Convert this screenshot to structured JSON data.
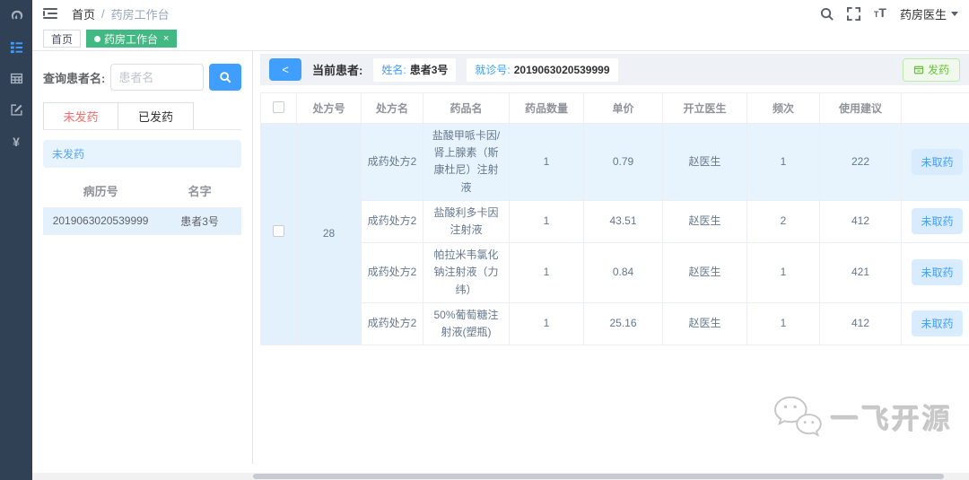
{
  "header": {
    "breadcrumb": {
      "home": "首页",
      "separator": "/",
      "current": "药房工作台"
    },
    "user": "药房医生",
    "icons": {
      "search": "magnifier",
      "fullscreen": "expand-arrows",
      "font_size": "tT",
      "user_caret": "caret-down"
    }
  },
  "sidebar": {
    "items": [
      {
        "icon": "dashboard-icon",
        "active": false
      },
      {
        "icon": "menu-list-icon",
        "active": true
      },
      {
        "icon": "table-grid-icon",
        "active": false
      },
      {
        "icon": "edit-icon",
        "active": false
      },
      {
        "icon": "currency-yen-icon",
        "active": false
      }
    ],
    "yen_glyph": "¥"
  },
  "tags": {
    "home": "首页",
    "active": "药房工作台",
    "close": "×"
  },
  "left_panel": {
    "search_label": "查询患者名:",
    "search_placeholder": "患者名",
    "tab_undispensed": "未发药",
    "tab_dispensed": "已发药",
    "alert": "未发药",
    "patient_table": {
      "headers": {
        "record_no": "病历号",
        "name": "名字"
      },
      "rows": [
        {
          "record_no": "2019063020539999",
          "name": "患者3号"
        }
      ]
    }
  },
  "main": {
    "back_label": "<",
    "current_patient_label": "当前患者:",
    "name_label": "姓名:",
    "name_value": "患者3号",
    "visit_label": "就诊号:",
    "visit_value": "2019063020539999",
    "dispense_button": "发药",
    "table": {
      "headers": [
        "处方号",
        "处方名",
        "药品名",
        "药品数量",
        "单价",
        "开立医生",
        "频次",
        "使用建议"
      ],
      "prescription_no": "28",
      "rows": [
        {
          "rx_name": "成药处方2",
          "drug": "盐酸甲哌卡因/肾上腺素（斯康杜尼）注射液",
          "qty": "1",
          "price": "0.79",
          "doctor": "赵医生",
          "freq": "1",
          "advice": "222",
          "action": "未取药"
        },
        {
          "rx_name": "成药处方2",
          "drug": "盐酸利多卡因注射液",
          "qty": "1",
          "price": "43.51",
          "doctor": "赵医生",
          "freq": "2",
          "advice": "412",
          "action": "未取药"
        },
        {
          "rx_name": "成药处方2",
          "drug": "帕拉米韦氯化钠注射液（力纬）",
          "qty": "1",
          "price": "0.84",
          "doctor": "赵医生",
          "freq": "1",
          "advice": "421",
          "action": "未取药"
        },
        {
          "rx_name": "成药处方2",
          "drug": "50%葡萄糖注射液(塑瓶)",
          "qty": "1",
          "price": "25.16",
          "doctor": "赵医生",
          "freq": "1",
          "advice": "412",
          "action": "未取药"
        }
      ]
    }
  },
  "watermark": {
    "text": "一飞开源"
  },
  "colors": {
    "accent_blue": "#409eff",
    "tag_green": "#42b983",
    "sidebar_bg": "#304156",
    "success_text": "#67c23a",
    "row_highlight": "#e8f4fd",
    "merged_cell": "#e3f1fd",
    "tab_active_red": "#f56c6c",
    "pill_bg": "#d9ecff"
  }
}
